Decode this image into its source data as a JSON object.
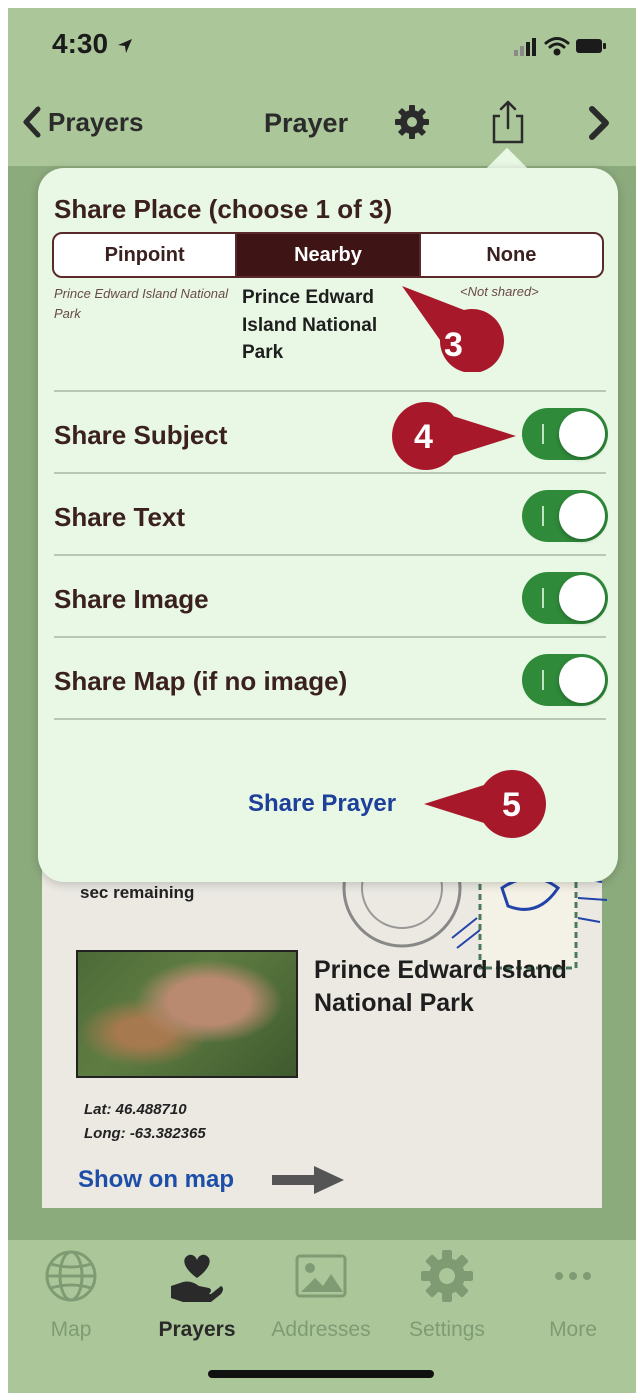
{
  "status_bar": {
    "time": "4:30"
  },
  "nav": {
    "back_label": "Prayers",
    "title": "Prayer"
  },
  "share_popover": {
    "title": "Share Place (choose 1 of 3)",
    "segments": [
      "Pinpoint",
      "Nearby",
      "None"
    ],
    "selected_segment": "Nearby",
    "pinpoint_value": "Prince Edward Island National Park",
    "nearby_value": "Prince Edward Island National Park",
    "none_value": "<Not shared>",
    "options": [
      {
        "label": "Share Subject",
        "on": true
      },
      {
        "label": "Share Text",
        "on": true
      },
      {
        "label": "Share Image",
        "on": true
      },
      {
        "label": "Share Map (if no image)",
        "on": true
      }
    ],
    "share_button": "Share Prayer"
  },
  "callouts": [
    "3",
    "4",
    "5"
  ],
  "prayer_card": {
    "remaining_text": "sec remaining",
    "place_name": "Prince Edward Island National Park",
    "lat": "Lat: 46.488710",
    "long": "Long: -63.382365",
    "show_on_map": "Show on map"
  },
  "tabs": [
    {
      "label": "Map",
      "icon": "globe-icon",
      "active": false
    },
    {
      "label": "Prayers",
      "icon": "heart-hand-icon",
      "active": true
    },
    {
      "label": "Addresses",
      "icon": "image-icon",
      "active": false
    },
    {
      "label": "Settings",
      "icon": "gear-icon",
      "active": false
    },
    {
      "label": "More",
      "icon": "more-icon",
      "active": false
    }
  ],
  "colors": {
    "header_green": "#abc79a",
    "popover_bg": "#e8f8e5",
    "maroon": "#3e1414",
    "toggle_on": "#2f8a3a",
    "link_blue": "#1e4fa8",
    "callout_red": "#a8182b"
  }
}
